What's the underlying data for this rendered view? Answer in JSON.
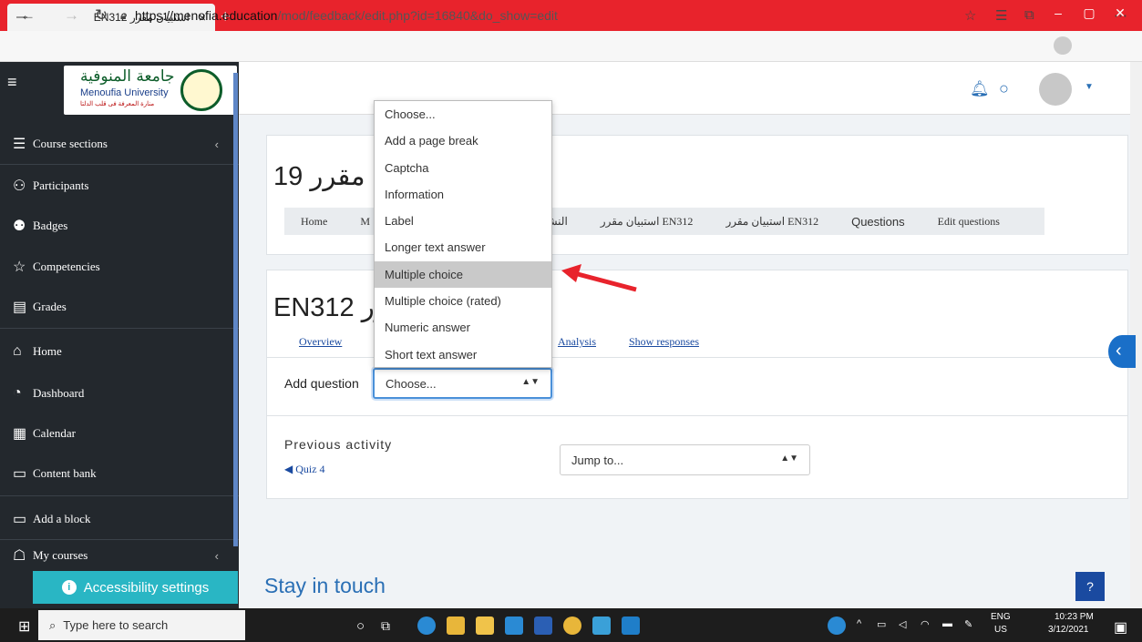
{
  "browser": {
    "tab_title": "استبيان مقرر EN312",
    "tab_close": "×",
    "new_tab": "+",
    "url_host": "https://menofia.education",
    "url_path": "/mod/feedback/edit.php?id=16840&do_show=edit",
    "win_min": "–",
    "win_max": "▢",
    "win_close": "✕"
  },
  "logo": {
    "arabic": "جامعة المنوفية",
    "english": "Menoufia University",
    "tagline": "منارة المعرفة فى قلب الدلتا"
  },
  "sidebar": {
    "items": [
      {
        "label": "Course sections",
        "icon": "list-icon",
        "glyph": "☰",
        "chevron": "‹"
      },
      {
        "label": "Participants",
        "icon": "users-icon",
        "glyph": "⚇"
      },
      {
        "label": "Badges",
        "icon": "badges-icon",
        "glyph": "⚉"
      },
      {
        "label": "Competencies",
        "icon": "star-icon",
        "glyph": "☆"
      },
      {
        "label": "Grades",
        "icon": "grades-icon",
        "glyph": "▤"
      },
      {
        "label": "Home",
        "icon": "home-icon",
        "glyph": "⌂"
      },
      {
        "label": "Dashboard",
        "icon": "dashboard-icon",
        "glyph": "◔"
      },
      {
        "label": "Calendar",
        "icon": "calendar-icon",
        "glyph": "▦"
      },
      {
        "label": "Content bank",
        "icon": "content-bank-icon",
        "glyph": "▭"
      },
      {
        "label": "Add a block",
        "icon": "add-block-icon",
        "glyph": "▭"
      },
      {
        "label": "My courses",
        "icon": "courses-icon",
        "glyph": "☖",
        "chevron": "‹"
      }
    ],
    "accessibility": "Accessibility settings"
  },
  "course_heading": "النشر والترجمة مقرر 19",
  "breadcrumbs": [
    "Home",
    "M",
    "النشر وال",
    "استبيان مقرر EN312",
    "استبيان مقرر EN312",
    "Questions",
    "Edit questions"
  ],
  "feedback_heading": "استبيان مقرر EN312",
  "tabs": {
    "overview": "Overview",
    "analysis": "Analysis",
    "show_responses": "Show responses"
  },
  "add_question": {
    "label": "Add question",
    "selected": "Choose...",
    "options": [
      "Choose...",
      "Add a page break",
      "Captcha",
      "Information",
      "Label",
      "Longer text answer",
      "Multiple choice",
      "Multiple choice (rated)",
      "Numeric answer",
      "Short text answer"
    ],
    "highlighted": "Multiple choice"
  },
  "previous": {
    "label": "Previous activity",
    "link": "◀ Quiz 4"
  },
  "jump": {
    "label": "Jump to..."
  },
  "footer": {
    "stay": "Stay in touch"
  },
  "taskbar": {
    "search_placeholder": "Type here to search",
    "lang1": "ENG",
    "lang2": "US",
    "time": "10:23 PM",
    "date": "3/12/2021"
  },
  "colors": {
    "browser_red": "#e8232c",
    "sidebar": "#23282d",
    "accent": "#1a6fc8",
    "annotation_arrow": "#e8232c"
  }
}
